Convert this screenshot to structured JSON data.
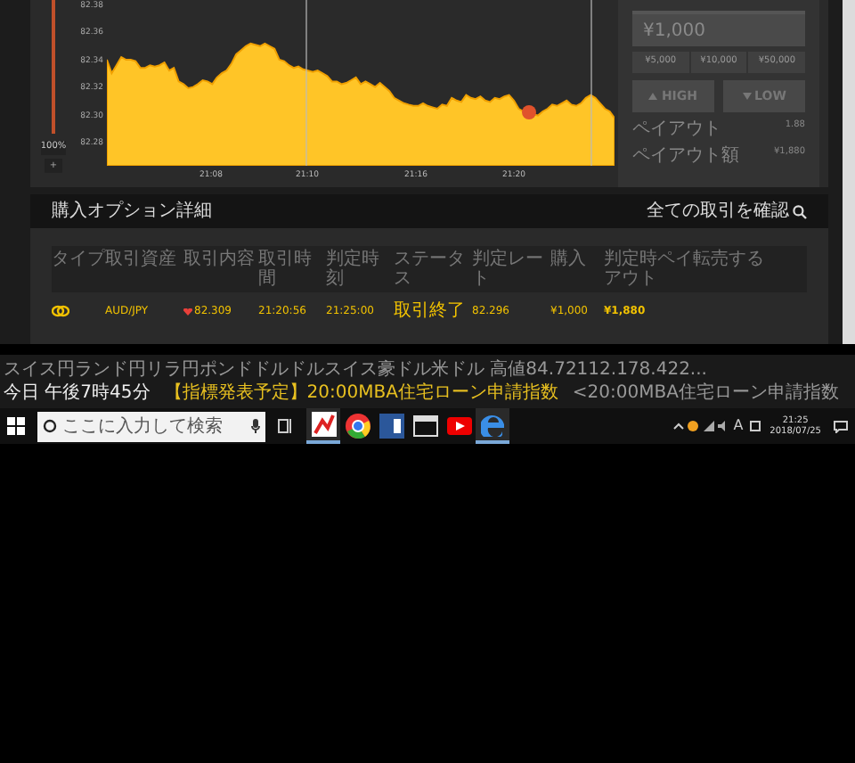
{
  "chart": {
    "y_labels": [
      "82.38",
      "82.36",
      "82.34",
      "82.32",
      "82.30",
      "82.28"
    ],
    "x_labels": [
      "21:08",
      "21:10",
      "21:16",
      "21:20"
    ]
  },
  "zoom_slider": {
    "label": "100%",
    "button": "+"
  },
  "trade_panel": {
    "amount": "¥1,000",
    "presets": [
      "¥5,000",
      "¥10,000",
      "¥50,000"
    ],
    "high": "HIGH",
    "low": "LOW",
    "rows": [
      {
        "label": "ペイアウト",
        "value": "1.88"
      },
      {
        "label": "ペイアウト額",
        "value": "¥1,880"
      }
    ]
  },
  "options": {
    "title": "購入オプション詳細",
    "link": "全ての取引を確認",
    "columns": [
      "タイプ",
      "取引資産",
      "取引内容",
      "取引時間",
      "判定時刻",
      "ステータス",
      "判定レート",
      "購入",
      "判定時ペイアウト",
      "転売する"
    ],
    "rows": [
      {
        "asset": "AUD/JPY",
        "low": true,
        "rate": "82.309",
        "time": "21:20:56",
        "expiry": "21:25:00",
        "status": "取引終了",
        "close_rate": "82.296",
        "purchase": "¥1,000",
        "payout": "¥1,880"
      }
    ]
  },
  "ticker": [
    "スイス円ランド円リラ円ポンドドルドルスイス豪ドル米ドル 高値84.72112.178.422...",
    "今日 午後7時45分",
    "【指標発表予定】20:00MBA住宅ローン申請指数",
    "<20:00MBA住宅ローン申請指数"
  ],
  "taskbar": {
    "search_placeholder": "ここに入力して検索",
    "apps": [
      {
        "kind": "chart",
        "active": true
      },
      {
        "kind": "chrome",
        "active": false
      },
      {
        "kind": "word",
        "active": false
      },
      {
        "kind": "window",
        "active": false
      },
      {
        "kind": "youtube",
        "active": false
      },
      {
        "kind": "edge",
        "active": true
      }
    ],
    "ime": "A",
    "time": "21:25",
    "date": "2018/07/25"
  }
}
